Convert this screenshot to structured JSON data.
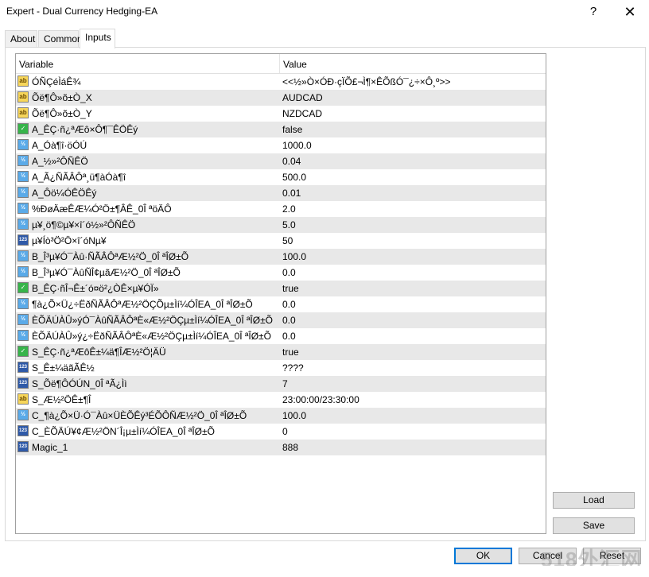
{
  "window": {
    "title": "Expert - Dual Currency Hedging-EA",
    "help": "?",
    "close": "✕"
  },
  "tabs": [
    {
      "label": "About"
    },
    {
      "label": "Common"
    },
    {
      "label": "Inputs"
    }
  ],
  "grid": {
    "headers": {
      "variable": "Variable",
      "value": "Value"
    },
    "rows": [
      {
        "icon": "ab",
        "variable": "ÓÑÇéÌáÊ¾",
        "value": "<<½»Ò×ÓÐ·çÏÕ£¬Ì¶×ÊÕßÓ¯¿÷×Ô¸º>>"
      },
      {
        "icon": "ab",
        "variable": "Õë¶Ô»õ±Ò_X",
        "value": "AUDCAD"
      },
      {
        "icon": "ab",
        "variable": "Õë¶Ô»õ±Ò_Y",
        "value": "NZDCAD"
      },
      {
        "icon": "bool",
        "variable": "A_ÊÇ·ñ¿ªÆô×Ô¶¯ÊÖÊý",
        "value": "false"
      },
      {
        "icon": "dbl",
        "variable": "A_Óà¶î·öÓÚ",
        "value": "1000.0"
      },
      {
        "icon": "dbl",
        "variable": "A_½»²ÔÑÊÖ",
        "value": "0.04"
      },
      {
        "icon": "dbl",
        "variable": "A_Ã¿ÑÃÂÔª¸ü¶àÓà¶î",
        "value": "500.0"
      },
      {
        "icon": "dbl",
        "variable": "A_Ôö¼ÓÊÖÊý",
        "value": "0.01"
      },
      {
        "icon": "dbl",
        "variable": "%ÐøÄæÊÆ¼Ó²Ö±¶ÂÊ_0Î ªöÄÔ",
        "value": "2.0"
      },
      {
        "icon": "dbl",
        "variable": "µ¥¸ö¶©µ¥×î´ó½»²ÔÑÊÖ",
        "value": "5.0"
      },
      {
        "icon": "int",
        "variable": "µ¥Íò³Ö²Ö×î´óNµ¥",
        "value": "50"
      },
      {
        "icon": "dbl",
        "variable": "B_Î³µ¥Ó¯Àû·ÑÃÂÔªÆ½²Ö_0Î ªÎØ±Õ",
        "value": "100.0"
      },
      {
        "icon": "dbl",
        "variable": "B_Î³µ¥Ó¯ÀûÑÎ¢µãÆ½²Ö_0Î ªÎØ±Õ",
        "value": "0.0"
      },
      {
        "icon": "bool",
        "variable": "B_ÊÇ·ñÎ¬Ê±´ó¤ö²¿ÒÊ×µ¥ÓÏ»",
        "value": "true"
      },
      {
        "icon": "dbl",
        "variable": "¶à¿Õ×Ü¿÷ËðÑÃÂÔªÆ½²ÖÇÕµ±Ìí¼ÓÎEA_0Î ªÎØ±Õ",
        "value": "0.0"
      },
      {
        "icon": "dbl",
        "variable": "ÈÕÄÚÀÛ»ýÓ¯ÀûÑÃÂÔªÈ«Æ½²ÖÇµ±Ìí¼ÓÎEA_0Î ªÎØ±Õ",
        "value": "0.0"
      },
      {
        "icon": "dbl",
        "variable": "ÈÕÄÚÀÛ»ý¿÷ËðÑÃÂÔªÈ«Æ½²ÖÇµ±Ìí¼ÓÎEA_0Î ªÎØ±Õ",
        "value": "0.0"
      },
      {
        "icon": "bool",
        "variable": "S_ÊÇ·ñ¿ªÆôÊ±¼ä¶ÎÆ½²Ö¦ÄÜ",
        "value": "true"
      },
      {
        "icon": "int",
        "variable": "S_Ê±¼äãÃÊ½",
        "value": "????"
      },
      {
        "icon": "int",
        "variable": "S_Õë¶ÔÓÚN_0Î ªÃ¿Ìì",
        "value": "7"
      },
      {
        "icon": "ab",
        "variable": "S_Æ½²ÖÊ±¶Î",
        "value": "23:00:00/23:30:00"
      },
      {
        "icon": "dbl",
        "variable": "C_¶à¿Õ×Ü·Ó¯Àû×ÜÈÕÊý³ÉÕÔÑÆ½²Ö_0Î ªÎØ±Õ",
        "value": "100.0"
      },
      {
        "icon": "int",
        "variable": "C_ÈÕÄÚ¥¢Æ½²ÖN´Î¡µ±Ìí¼ÓÎEA_0Î ªÎØ±Õ",
        "value": "0"
      },
      {
        "icon": "int",
        "variable": "Magic_1",
        "value": "888"
      }
    ]
  },
  "buttons": {
    "load": "Load",
    "save": "Save",
    "ok": "OK",
    "cancel": "Cancel",
    "reset": "Reset"
  },
  "watermark": "518外汇网",
  "colors": {
    "ok_border": "#0078d7",
    "alt_row": "#e8e8e8"
  }
}
